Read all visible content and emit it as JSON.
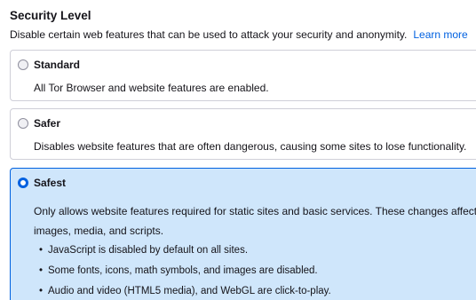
{
  "section": {
    "title": "Security Level",
    "description": "Disable certain web features that can be used to attack your security and anonymity.",
    "learn_more": "Learn more"
  },
  "levels": [
    {
      "label": "Standard",
      "selected": false,
      "description": "All Tor Browser and website features are enabled."
    },
    {
      "label": "Safer",
      "selected": false,
      "description": "Disables website features that are often dangerous, causing some sites to lose functionality."
    },
    {
      "label": "Safest",
      "selected": true,
      "description": "Only allows website features required for static sites and basic services. These changes affect images, media, and scripts.",
      "bullets": [
        "JavaScript is disabled by default on all sites.",
        "Some fonts, icons, math symbols, and images are disabled.",
        "Audio and video (HTML5 media), and WebGL are click-to-play."
      ]
    }
  ],
  "colors": {
    "accent": "#0061e0",
    "selected_background": "#cfe6fb",
    "card_border": "#cfcfd8"
  }
}
